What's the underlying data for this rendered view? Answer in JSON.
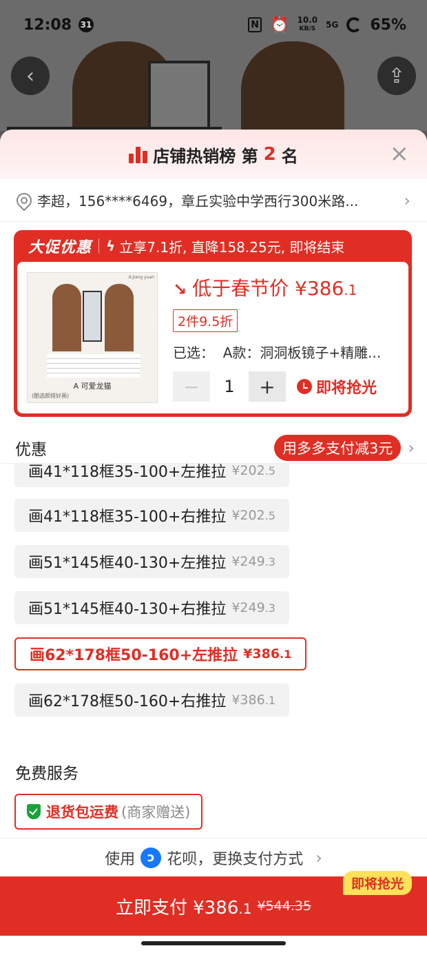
{
  "status_bar": {
    "time": "12:08",
    "calendar_badge": "31",
    "net_speed_value": "10.0",
    "net_speed_unit": "KB/S",
    "signal": "5G",
    "battery": "65%"
  },
  "sheet": {
    "rank_title": "店铺热销榜 第",
    "rank_number": "2",
    "rank_suffix": "名",
    "close_icon": "×"
  },
  "address": {
    "text": "李超，156****6469，章丘实验中学西行300米路..."
  },
  "promo": {
    "tag": "大促优惠",
    "text": "立享7.1折, 直降158.25元, 即将结束",
    "price_label": "低于春节价 ¥386",
    "price_decimal": ".1",
    "discount_tag": "2件9.5折",
    "selected_label": "已选：",
    "selected_value": "A款：洞洞板镜子+精雕...",
    "quantity": "1",
    "minus": "−",
    "plus": "+",
    "sellout_label": "即将抢光",
    "thumb_label": "A  可爱龙猫",
    "thumb_caption": "(酷选颜搭好画)",
    "thumb_brand": "A.Jiang yuan"
  },
  "discount": {
    "label": "优惠",
    "pill": "用多多支付减3元"
  },
  "skus": [
    {
      "name": "画41*118框35-100+左推拉",
      "price": "¥202",
      "dec": ".5",
      "selected": false
    },
    {
      "name": "画41*118框35-100+右推拉",
      "price": "¥202",
      "dec": ".5",
      "selected": false
    },
    {
      "name": "画51*145框40-130+左推拉",
      "price": "¥249",
      "dec": ".3",
      "selected": false
    },
    {
      "name": "画51*145框40-130+右推拉",
      "price": "¥249",
      "dec": ".3",
      "selected": false
    },
    {
      "name": "画62*178框50-160+左推拉",
      "price": "¥386",
      "dec": ".1",
      "selected": true
    },
    {
      "name": "画62*178框50-160+右推拉",
      "price": "¥386",
      "dec": ".1",
      "selected": false
    }
  ],
  "services": {
    "title": "免费服务",
    "main": "退货包运费",
    "sub": "(商家赠送)"
  },
  "payment": {
    "use_label": "使用",
    "method": "花呗，更换支付方式",
    "pay_label": "立即支付 ¥386",
    "pay_decimal": ".1",
    "original_price": "¥544.35",
    "badge": "即将抢光"
  }
}
